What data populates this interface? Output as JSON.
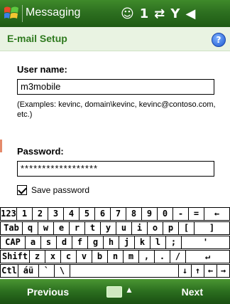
{
  "statusbar": {
    "app_title": "Messaging",
    "icons": [
      "notification-icon",
      "one-icon",
      "connectivity-icon",
      "signal-icon",
      "volume-icon"
    ]
  },
  "header": {
    "title": "E-mail Setup",
    "help_icon": "help-icon"
  },
  "form": {
    "username_label": "User name:",
    "username_value": "m3mobile",
    "hint": "(Examples: kevinc, domain\\kevinc, kevinc@contoso.com, etc.)",
    "password_label": "Password:",
    "password_value": "******************",
    "save_password_label": "Save password",
    "save_password_checked": true
  },
  "keyboard": {
    "rows": [
      [
        "123",
        "1",
        "2",
        "3",
        "4",
        "5",
        "6",
        "7",
        "8",
        "9",
        "0",
        "-",
        "=",
        "←"
      ],
      [
        "Tab",
        "q",
        "w",
        "e",
        "r",
        "t",
        "y",
        "u",
        "i",
        "o",
        "p",
        "[",
        "]"
      ],
      [
        "CAP",
        "a",
        "s",
        "d",
        "f",
        "g",
        "h",
        "j",
        "k",
        "l",
        ";",
        "'"
      ],
      [
        "Shift",
        "z",
        "x",
        "c",
        "v",
        "b",
        "n",
        "m",
        ",",
        ".",
        "/",
        "↵"
      ],
      [
        "Ctl",
        "áü",
        "`",
        "\\",
        " ",
        "↓",
        "↑",
        "←",
        "→"
      ]
    ]
  },
  "softbar": {
    "left": "Previous",
    "right": "Next",
    "center_icon": "keyboard-icon"
  }
}
